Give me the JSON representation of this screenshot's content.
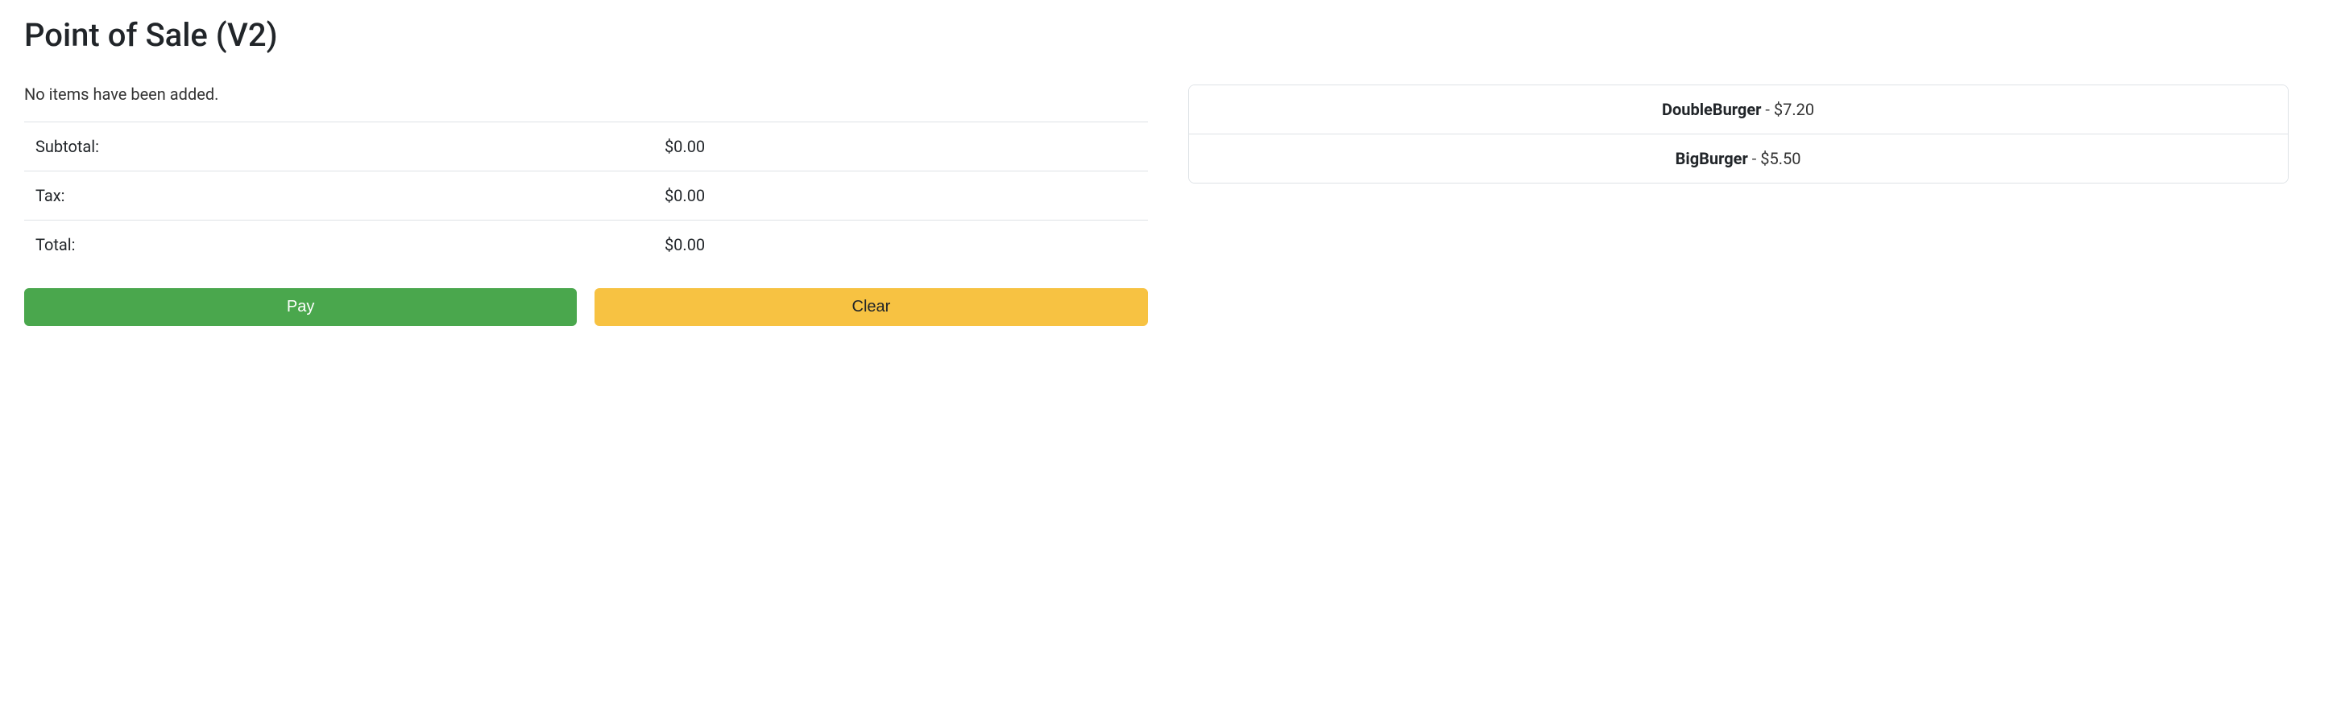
{
  "header": {
    "title": "Point of Sale (V2)"
  },
  "cart": {
    "empty_message": "No items have been added.",
    "summary": {
      "subtotal_label": "Subtotal:",
      "subtotal_value": "$0.00",
      "tax_label": "Tax:",
      "tax_value": "$0.00",
      "total_label": "Total:",
      "total_value": "$0.00"
    },
    "buttons": {
      "pay_label": "Pay",
      "clear_label": "Clear"
    }
  },
  "products": [
    {
      "name": "DoubleBurger",
      "sep": " - ",
      "price": "$7.20"
    },
    {
      "name": "BigBurger",
      "sep": " - ",
      "price": "$5.50"
    }
  ]
}
